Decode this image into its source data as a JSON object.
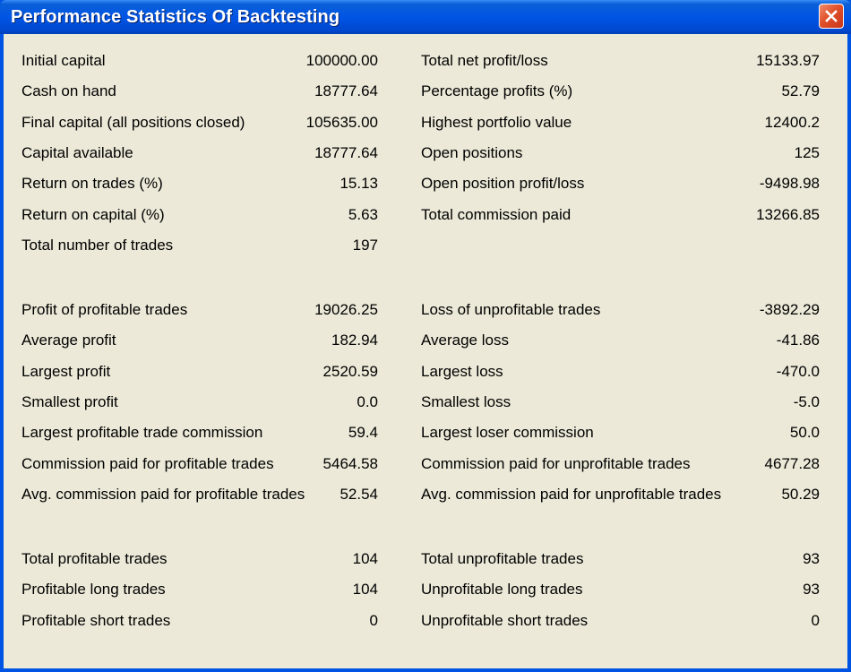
{
  "window": {
    "title": "Performance Statistics Of Backtesting"
  },
  "left_column": {
    "group1": [
      {
        "label": "Initial capital",
        "value": "100000.00"
      },
      {
        "label": "Cash on hand",
        "value": "18777.64"
      },
      {
        "label": "Final capital (all positions closed)",
        "value": "105635.00"
      },
      {
        "label": "Capital available",
        "value": "18777.64"
      },
      {
        "label": "Return on trades (%)",
        "value": "15.13"
      },
      {
        "label": "Return on capital (%)",
        "value": "5.63"
      },
      {
        "label": "Total number of trades",
        "value": "197"
      }
    ],
    "group2": [
      {
        "label": "Profit of profitable trades",
        "value": "19026.25"
      },
      {
        "label": "Average profit",
        "value": "182.94"
      },
      {
        "label": "Largest profit",
        "value": "2520.59"
      },
      {
        "label": "Smallest profit",
        "value": "0.0"
      },
      {
        "label": "Largest profitable trade commission",
        "value": "59.4"
      },
      {
        "label": "Commission paid for profitable trades",
        "value": "5464.58"
      },
      {
        "label": "Avg. commission paid for profitable trades",
        "value": "52.54"
      }
    ],
    "group3": [
      {
        "label": "Total profitable trades",
        "value": "104"
      },
      {
        "label": "Profitable long trades",
        "value": "104"
      },
      {
        "label": "Profitable short trades",
        "value": "0"
      }
    ]
  },
  "right_column": {
    "group1": [
      {
        "label": "Total net profit/loss",
        "value": "15133.97"
      },
      {
        "label": "Percentage profits (%)",
        "value": "52.79"
      },
      {
        "label": "Highest portfolio value",
        "value": "12400.2"
      },
      {
        "label": "Open positions",
        "value": "125"
      },
      {
        "label": "Open position profit/loss",
        "value": "-9498.98"
      },
      {
        "label": "Total commission paid",
        "value": "13266.85"
      }
    ],
    "group2": [
      {
        "label": "Loss of unprofitable trades",
        "value": "-3892.29"
      },
      {
        "label": "Average loss",
        "value": "-41.86"
      },
      {
        "label": "Largest loss",
        "value": "-470.0"
      },
      {
        "label": "Smallest loss",
        "value": "-5.0"
      },
      {
        "label": "Largest loser commission",
        "value": "50.0"
      },
      {
        "label": "Commission paid for unprofitable trades",
        "value": "4677.28"
      },
      {
        "label": "Avg. commission paid for unprofitable trades",
        "value": "50.29"
      }
    ],
    "group3": [
      {
        "label": "Total unprofitable trades",
        "value": "93"
      },
      {
        "label": "Unprofitable long trades",
        "value": "93"
      },
      {
        "label": "Unprofitable short trades",
        "value": "0"
      }
    ]
  },
  "icons": {
    "close": "close-icon"
  },
  "colors": {
    "titlebar": "#0055e5",
    "close_button": "#e0502a",
    "client_background": "#ece9d8"
  }
}
